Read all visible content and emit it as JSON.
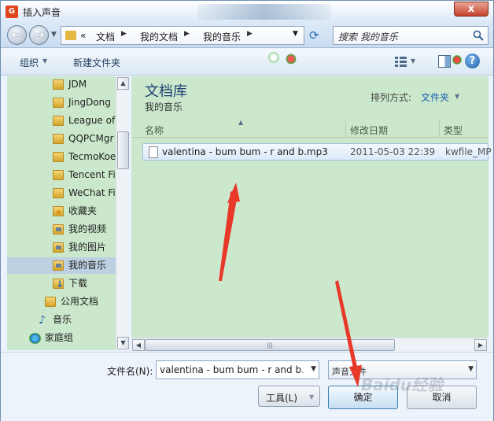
{
  "window": {
    "title": "插入声音",
    "close": "x"
  },
  "nav": {
    "breadcrumb": [
      "«",
      "文档",
      "我的文档",
      "我的音乐"
    ],
    "search_placeholder": "搜索 我的音乐"
  },
  "toolbar": {
    "organize": "组织",
    "new_folder": "新建文件夹"
  },
  "tree": {
    "items": [
      "JDM",
      "JingDong",
      "League of",
      "QQPCMgr",
      "TecmoKoe",
      "Tencent Fi",
      "WeChat Fi",
      "收藏夹",
      "我的视频",
      "我的图片",
      "我的音乐",
      "下载",
      "公用文档",
      "音乐",
      "家庭组"
    ],
    "selected": "我的音乐"
  },
  "library": {
    "title": "文档库",
    "subtitle": "我的音乐",
    "arrange_label": "排列方式:",
    "arrange_value": "文件夹"
  },
  "columns": {
    "name": "名称",
    "date": "修改日期",
    "type": "类型"
  },
  "files": [
    {
      "name": "valentina - bum bum - r and b.mp3",
      "date": "2011-05-03 22:39",
      "type": "kwfile_MP"
    }
  ],
  "bottom": {
    "filename_label": "文件名(N):",
    "filename_value": "valentina - bum bum - r and b.r",
    "filetype_value": "声音文件",
    "tools_label": "工具(L)",
    "ok_label": "确定",
    "cancel_label": "取消"
  },
  "watermark": "Baidu经验",
  "colors": {
    "pane_bg": "#cbe8cc",
    "link": "#1d5fb1",
    "annotation_arrow": "#e8382a"
  }
}
